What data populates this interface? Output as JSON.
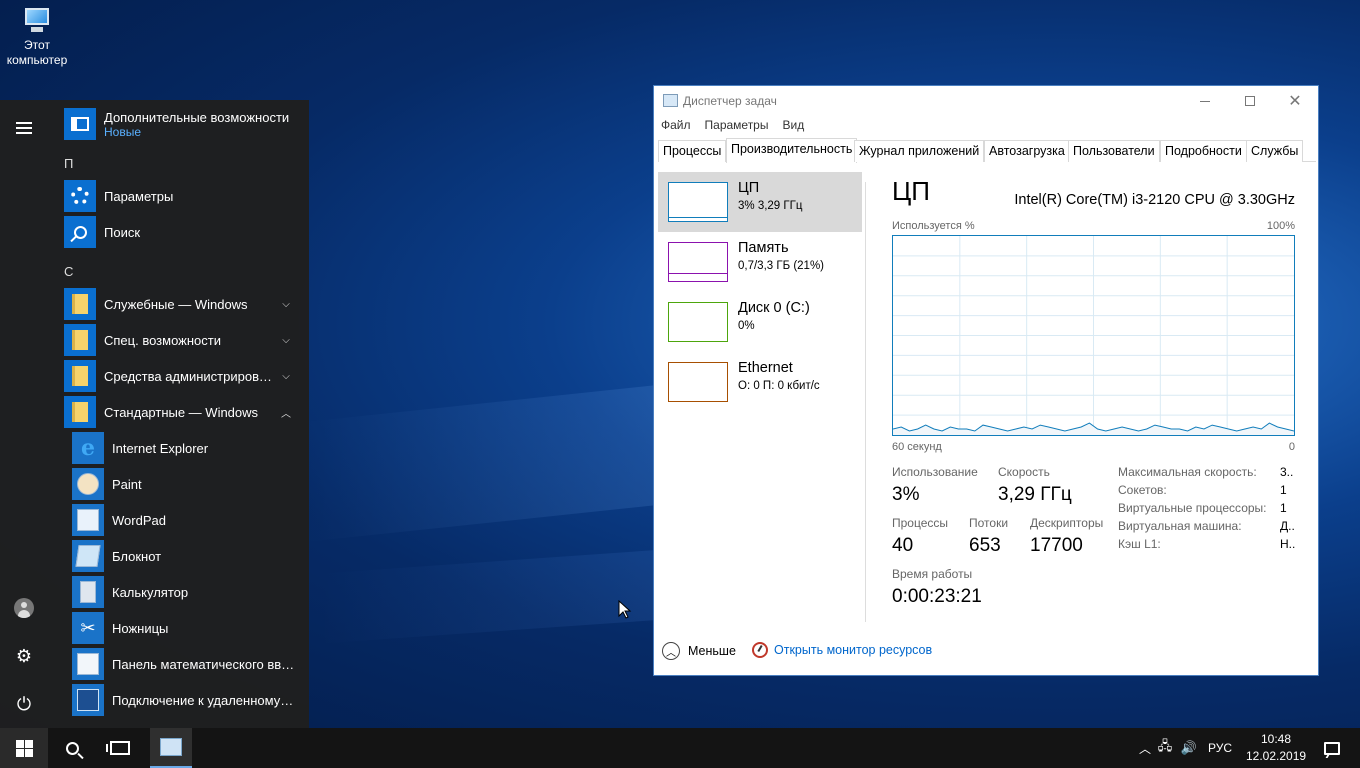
{
  "desktop": {
    "icon_label_line1": "Этот",
    "icon_label_line2": "компьютер"
  },
  "start_menu": {
    "items": [
      {
        "label": "Дополнительные возможности",
        "sublabel": "Новые"
      },
      {
        "letter": "П"
      },
      {
        "label": "Параметры"
      },
      {
        "label": "Поиск"
      },
      {
        "letter": "С"
      },
      {
        "label": "Служебные — Windows"
      },
      {
        "label": "Спец. возможности"
      },
      {
        "label": "Средства администрировани..."
      },
      {
        "label": "Стандартные — Windows"
      },
      {
        "label": "Internet Explorer"
      },
      {
        "label": "Paint"
      },
      {
        "label": "WordPad"
      },
      {
        "label": "Блокнот"
      },
      {
        "label": "Калькулятор"
      },
      {
        "label": "Ножницы"
      },
      {
        "label": "Панель математического ввода"
      },
      {
        "label": "Подключение к удаленному ра..."
      }
    ]
  },
  "task_manager": {
    "title": "Диспетчер задач",
    "menu": [
      "Файл",
      "Параметры",
      "Вид"
    ],
    "tabs": [
      "Процессы",
      "Производительность",
      "Журнал приложений",
      "Автозагрузка",
      "Пользователи",
      "Подробности",
      "Службы"
    ],
    "active_tab": "Производительность",
    "resources": [
      {
        "name": "ЦП",
        "detail": "3% 3,29 ГГц",
        "color": "#117dbb"
      },
      {
        "name": "Память",
        "detail": "0,7/3,3 ГБ (21%)",
        "color": "#8b12ae"
      },
      {
        "name": "Диск 0 (C:)",
        "detail": "0%",
        "color": "#4da60c"
      },
      {
        "name": "Ethernet",
        "detail": "О: 0 П: 0 кбит/с",
        "color": "#a74f01"
      }
    ],
    "cpu": {
      "heading": "ЦП",
      "model": "Intel(R) Core(TM) i3-2120 CPU @ 3.30GHz",
      "graph_left_label": "Используется %",
      "graph_right_label": "100%",
      "time_left_label": "60 секунд",
      "time_right_label": "0",
      "usage_label": "Использование",
      "usage_value": "3%",
      "speed_label": "Скорость",
      "speed_value": "3,29 ГГц",
      "processes_label": "Процессы",
      "processes_value": "40",
      "threads_label": "Потоки",
      "threads_value": "653",
      "handles_label": "Дескрипторы",
      "handles_value": "17700",
      "uptime_label": "Время работы",
      "uptime_value": "0:00:23:21",
      "specs": [
        {
          "label": "Максимальная скорость:",
          "value": "3.."
        },
        {
          "label": "Сокетов:",
          "value": "1"
        },
        {
          "label": "Виртуальные процессоры:",
          "value": "1"
        },
        {
          "label": "Виртуальная машина:",
          "value": "Д.."
        },
        {
          "label": "Кэш L1:",
          "value": "Н.."
        }
      ],
      "usage_history_percent": [
        3,
        4,
        2,
        3,
        5,
        3,
        2,
        4,
        3,
        3,
        2,
        5,
        4,
        3,
        2,
        3,
        4,
        3,
        5,
        4,
        3,
        2,
        3,
        4,
        6,
        3,
        2,
        3,
        4,
        3,
        2,
        3,
        5,
        4,
        3,
        3,
        2,
        4,
        3,
        5,
        4,
        3,
        2,
        3,
        4,
        3,
        6,
        4,
        3,
        2
      ]
    },
    "footer": {
      "less": "Меньше",
      "open_monitor": "Открыть монитор ресурсов"
    }
  },
  "taskbar": {
    "language": "РУС",
    "time": "10:48",
    "date": "12.02.2019"
  }
}
